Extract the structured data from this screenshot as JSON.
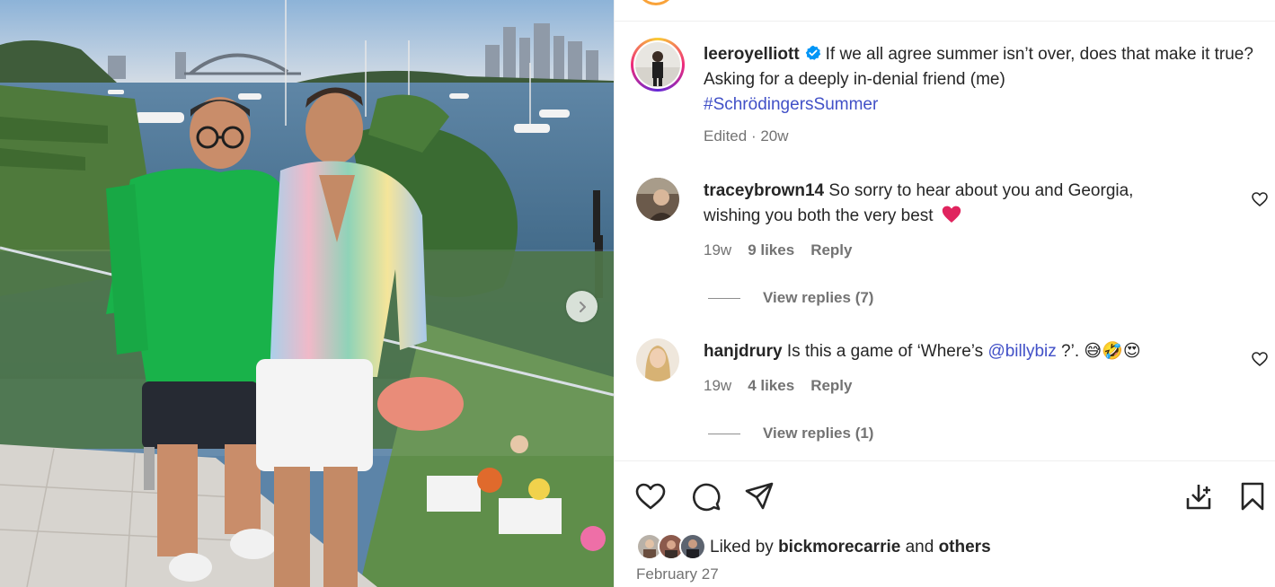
{
  "post": {
    "username": "leeroyelliott",
    "caption": "If we all agree summer isn’t over, does that make it true? Asking for a deeply in-denial friend (me)",
    "hashtag": "#SchrödingersSummer",
    "edited": "Edited",
    "age": "20w",
    "separator": "·"
  },
  "comments": [
    {
      "username": "traceybrown14",
      "text_line1": "So sorry to hear about you and Georgia,",
      "text_line2": "wishing you both the very best",
      "emoji": "❤️",
      "age": "19w",
      "likes": "9 likes",
      "reply_label": "Reply",
      "view_replies": "View replies (7)"
    },
    {
      "username": "hanjdrury",
      "text_before": "Is this a game of ‘Where’s",
      "mention": "@billybiz",
      "text_after": "?’.",
      "emoji": "😅🤣😍",
      "age": "19w",
      "likes": "4 likes",
      "reply_label": "Reply",
      "view_replies": "View replies (1)"
    }
  ],
  "likes_summary": {
    "prefix": "Liked by",
    "user": "bickmorecarrie",
    "conjunction": "and",
    "others": "others"
  },
  "date": "February 27",
  "icons": {
    "like": "heart-icon",
    "comment": "comment-icon",
    "share": "share-icon",
    "save_download": "download-icon",
    "bookmark": "bookmark-icon",
    "next": "chevron-right-icon",
    "verified": "verified-badge-icon"
  },
  "colors": {
    "link": "#4150c7",
    "verified": "#0095f6",
    "muted": "#737373",
    "text": "#262626",
    "heart_emoji": "#e0245e"
  }
}
